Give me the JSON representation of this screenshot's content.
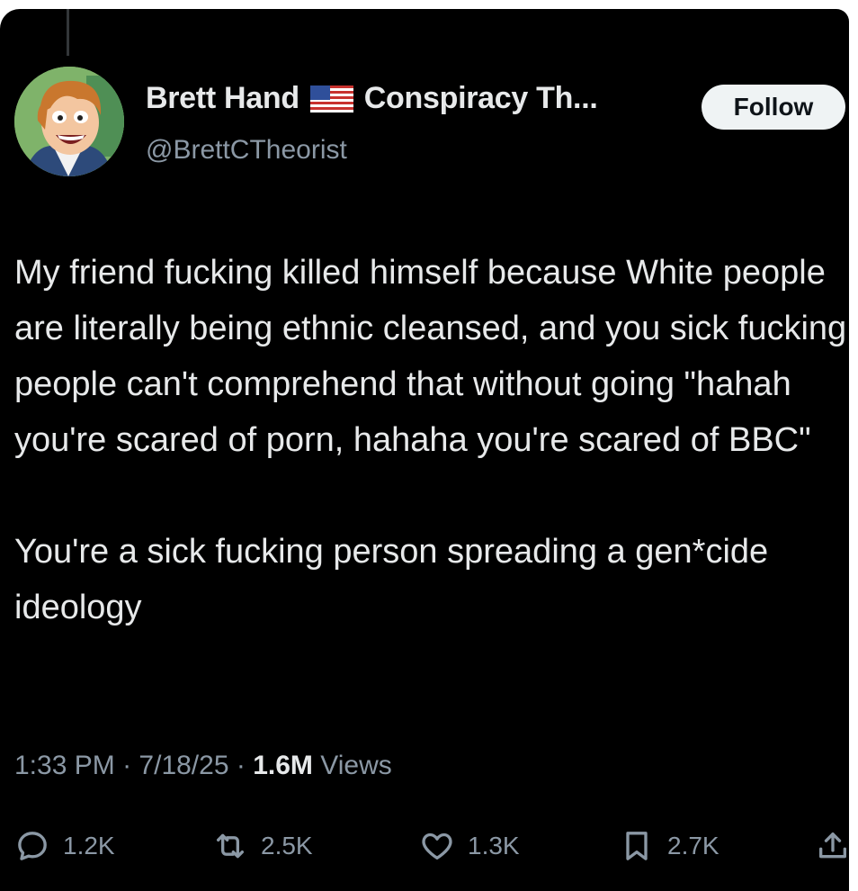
{
  "tweet": {
    "display_name": "Brett Hand",
    "flag_icon": "us-flag-icon",
    "name_suffix": "Conspiracy Th...",
    "handle": "@BrettCTheorist",
    "follow_label": "Follow",
    "paragraphs": [
      "My friend fucking killed himself because White people are literally being ethnic cleansed, and you sick fucking people can't comprehend that without going \"hahah you're scared of porn, hahaha you're scared of BBC\"",
      "You're a sick fucking person spreading a gen*cide ideology"
    ],
    "time": "1:33 PM",
    "date": "7/18/25",
    "views_count": "1.6M",
    "views_label": "Views",
    "separator": "·"
  },
  "actions": {
    "replies": "1.2K",
    "reposts": "2.5K",
    "likes": "1.3K",
    "bookmarks": "2.7K"
  },
  "colors": {
    "background": "#000000",
    "text": "#e7e9ea",
    "muted": "#8b98a5",
    "follow_bg": "#eff3f4"
  }
}
